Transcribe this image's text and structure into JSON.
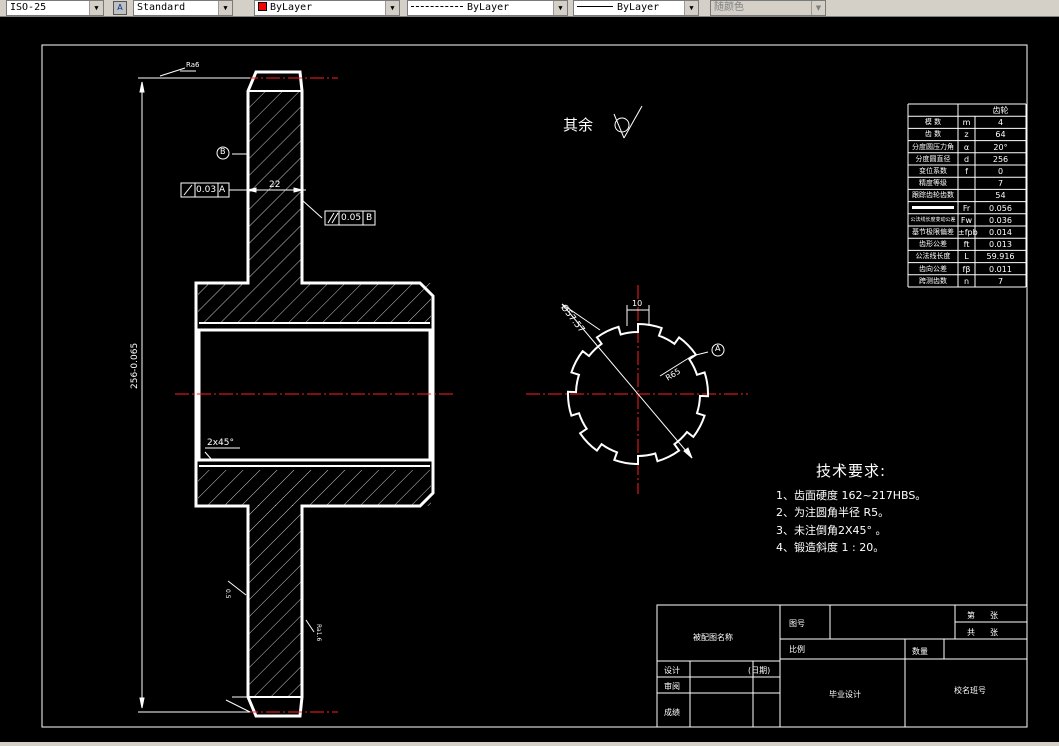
{
  "toolbar": {
    "dimstyle": "ISO-25",
    "textstyle": "Standard",
    "layer_color": "ByLayer",
    "linetype": "ByLayer",
    "lineweight": "ByLayer",
    "plotstyle": "随颜色"
  },
  "drawing": {
    "roughness_rest": "其余",
    "ra_top": "Ra6",
    "width_dim": "22",
    "diameter_dim": "256-0.065",
    "chamfer": "2x45°",
    "runout_tol": "0.03",
    "runout_datum": "A",
    "parallel_tol": "0.05",
    "parallel_datum": "B",
    "datum_b": "B",
    "datum_a": "A",
    "keyway_width": "10",
    "spline_dia": "Ø57.57",
    "spline_radius": "R65",
    "tolerance_small": "0.5",
    "ra_small": "Ra1.6"
  },
  "gear_table": {
    "header": "齿轮",
    "rows": [
      {
        "name": "模 数",
        "sym": "m",
        "val": "4"
      },
      {
        "name": "齿 数",
        "sym": "z",
        "val": "64"
      },
      {
        "name": "分度圆压力角",
        "sym": "α",
        "val": "20°"
      },
      {
        "name": "分度圆直径",
        "sym": "d",
        "val": "256"
      },
      {
        "name": "变位系数",
        "sym": "f",
        "val": "0"
      },
      {
        "name": "精度等级",
        "sym": "",
        "val": "7"
      },
      {
        "name": "跟踪齿轮齿数",
        "sym": "",
        "val": "54"
      },
      {
        "name": "",
        "sym": "Fr",
        "val": "0.056"
      },
      {
        "name": "公法线长度变动公差",
        "sym": "Fw",
        "val": "0.036"
      },
      {
        "name": "基节极限偏差",
        "sym": "±fpb",
        "val": "0.014"
      },
      {
        "name": "齿形公差",
        "sym": "ft",
        "val": "0.013"
      },
      {
        "name": "公法线长度",
        "sym": "L",
        "val": "59.916"
      },
      {
        "name": "齿向公差",
        "sym": "fβ",
        "val": "0.011"
      },
      {
        "name": "跨测齿数",
        "sym": "n",
        "val": "7"
      }
    ]
  },
  "tech_req": {
    "title": "技术要求:",
    "items": [
      "1、齿面硬度 162~217HBS。",
      "2、为注圆角半径 R5。",
      "3、未注倒角2X45° 。",
      "4、锻造斜度 1 : 20。"
    ]
  },
  "title_block": {
    "part_name": "被配图名称",
    "drawing_no": "图号",
    "scale": "比例",
    "quantity": "数量",
    "sheet": "第",
    "sheet_unit": "张",
    "total": "共",
    "total_unit": "张",
    "design": "设计",
    "date": "(日期)",
    "review": "审阅",
    "grade": "成绩",
    "graduation": "毕业设计",
    "school": "校名班号"
  },
  "colors": {
    "outline": "#ffffff",
    "center": "#ff0000",
    "background": "#000000"
  }
}
